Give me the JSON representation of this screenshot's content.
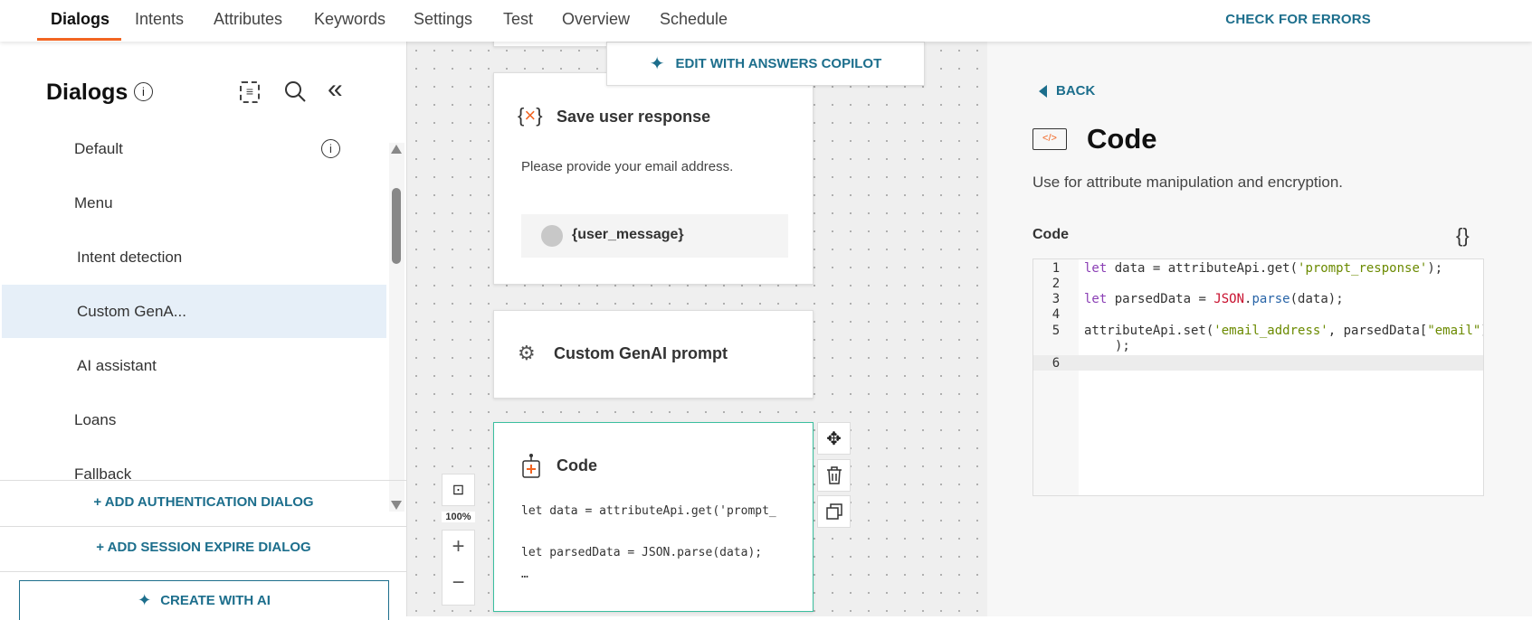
{
  "nav": {
    "tabs": [
      "Dialogs",
      "Intents",
      "Attributes",
      "Keywords",
      "Settings",
      "Test",
      "Overview",
      "Schedule"
    ],
    "active": "Dialogs",
    "check_errors": "CHECK FOR ERRORS"
  },
  "sidebar": {
    "title": "Dialogs",
    "items": [
      "Default",
      "Menu",
      "Intent detection",
      "Custom GenA...",
      "AI assistant",
      "Loans",
      "Fallback"
    ],
    "selected": "Custom GenA...",
    "add_auth": "+ ADD AUTHENTICATION DIALOG",
    "add_session": "+ ADD SESSION EXPIRE DIALOG",
    "create_ai": "CREATE WITH AI"
  },
  "canvas": {
    "copilot": "EDIT WITH ANSWERS COPILOT",
    "zoom": "100%",
    "save_node": {
      "title": "Save user response",
      "text": "Please provide your email address.",
      "var": "{user_message}"
    },
    "genai_node": {
      "title": "Custom GenAI prompt"
    },
    "code_node": {
      "title": "Code",
      "line1": "let data = attributeApi.get('prompt_",
      "line2": "let parsedData = JSON.parse(data);",
      "ellipsis": "…"
    }
  },
  "panel": {
    "back": "BACK",
    "title": "Code",
    "description": "Use for attribute manipulation and encryption.",
    "code_label": "Code",
    "line_numbers": [
      "1",
      "2",
      "3",
      "4",
      "5",
      "6"
    ]
  },
  "colors": {
    "accent": "#f26522",
    "link": "#1c6e8c",
    "selected": "#e6eff8",
    "active_node": "#3bbf9f"
  }
}
